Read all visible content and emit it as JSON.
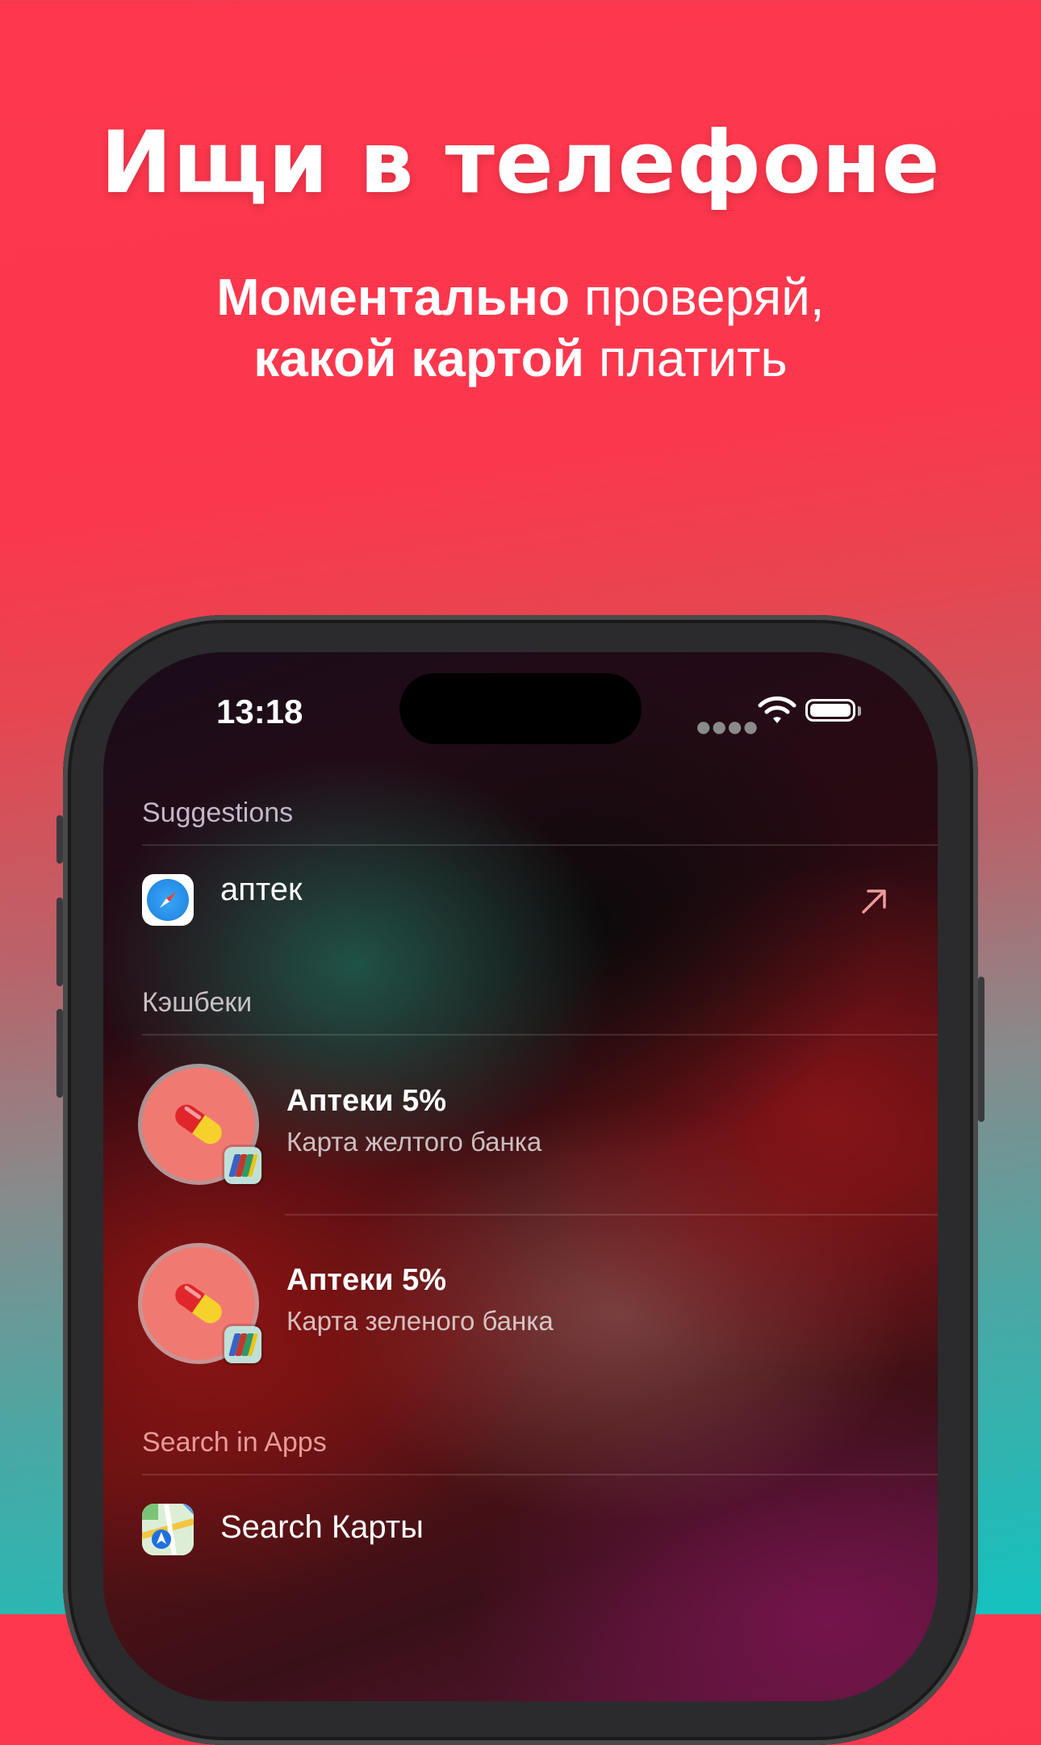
{
  "promo": {
    "headline": "Ищи в телефоне",
    "line1_bold": "Моментально",
    "line1_regular": " проверяй,",
    "line2_bold": "какой картой",
    "line2_regular": " платить"
  },
  "status_bar": {
    "time": "13:18",
    "icons": [
      "cellular-dots-icon",
      "wifi-icon",
      "battery-icon"
    ]
  },
  "suggestions": {
    "header": "Suggestions",
    "item": {
      "icon": "safari-icon",
      "text": "аптек",
      "action_icon": "arrow-up-right-icon"
    }
  },
  "cashback": {
    "header": "Кэшбеки",
    "items": [
      {
        "title": "Аптеки 5%",
        "subtitle": "Карта желтого банка",
        "icon": "pill-icon",
        "badge": "bank-cards-icon"
      },
      {
        "title": "Аптеки 5%",
        "subtitle": "Карта зеленого банка",
        "icon": "pill-icon",
        "badge": "bank-cards-icon"
      }
    ]
  },
  "search_in_apps": {
    "header": "Search in Apps",
    "item": {
      "icon": "maps-icon",
      "text": "Search Карты"
    }
  },
  "colors": {
    "accent_top": "#fe374c",
    "accent_bottom": "#13c2bf",
    "section_header_suggestions": "#c2b7c8",
    "section_header_search_in_apps": "#e79a9a"
  }
}
